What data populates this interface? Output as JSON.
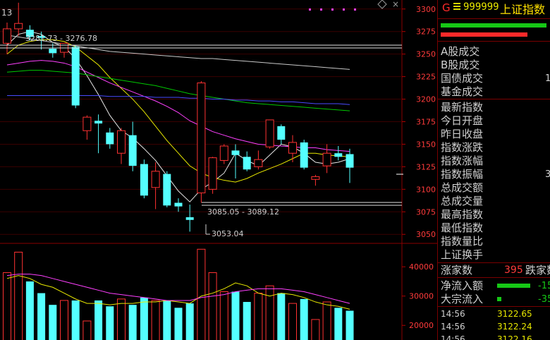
{
  "header": {
    "market_code": "G",
    "code": "999999",
    "name": "上证指数"
  },
  "top_left_label": "13",
  "indicator_bars": [
    {
      "color": "#16c816",
      "fraction": 1.0
    },
    {
      "color": "#ff2a2a",
      "fraction": 0.82
    }
  ],
  "colors": {
    "up": "#ff3232",
    "down": "#54ffff",
    "ma5": "#e8e8e8",
    "ma10": "#e8e800",
    "ma20": "#ff40ff",
    "ma30": "#00c800",
    "ma60": "#4a4aff",
    "ma_long": "#c8c8c8"
  },
  "price_axis": {
    "ticks": [
      "3300",
      "3275",
      "3250",
      "3225",
      "3200",
      "3175",
      "3150",
      "3125",
      "3100",
      "3075",
      "3050"
    ]
  },
  "volume_axis": {
    "ticks": [
      "40000",
      "30000",
      "20000"
    ]
  },
  "annotations": {
    "high_range": "3281.73 - 3276.78",
    "low_range": "3085.05 - 3089.12",
    "low_point": "3053.04"
  },
  "quote_labels": {
    "a_turnover": "A股成交",
    "b_turnover": "B股成交",
    "bond_turnover": "国债成交",
    "fund_turnover": "基金成交",
    "latest": "最新指数",
    "open": "今日开盘",
    "prev_close": "昨日收盘",
    "change": "指数涨跌",
    "change_pct": "指数涨幅",
    "amplitude": "指数振幅",
    "total_amount": "总成交额",
    "total_volume": "总成交量",
    "high": "最高指数",
    "low": "最低指数",
    "volume_ratio": "指数量比",
    "turnover_rate": "上证换手"
  },
  "cut_values": {
    "bond": "1",
    "amplitude": "3"
  },
  "breadth": {
    "up_label": "涨家数",
    "up_count": "395",
    "down_label": "跌家数"
  },
  "flows": [
    {
      "label": "净流入额",
      "value": "-15",
      "color": "#16c816",
      "fraction": 0.85
    },
    {
      "label": "大宗流入",
      "value": "-35",
      "color": "#16c816",
      "fraction": 0.1
    }
  ],
  "ticks_list": [
    {
      "time": "14:56",
      "price": "3122.65"
    },
    {
      "time": "14:56",
      "price": "3122.24"
    },
    {
      "time": "14:56",
      "price": "3122.16"
    }
  ],
  "chart_data": {
    "type": "candlestick",
    "price_range": [
      3040,
      3310
    ],
    "volume_range": [
      15000,
      48000
    ],
    "candles": [
      {
        "o": 3262,
        "h": 3285,
        "l": 3250,
        "c": 3278
      },
      {
        "o": 3278,
        "h": 3307,
        "l": 3270,
        "c": 3284
      },
      {
        "o": 3277,
        "h": 3282,
        "l": 3265,
        "c": 3269
      },
      {
        "o": 3270,
        "h": 3275,
        "l": 3255,
        "c": 3268
      },
      {
        "o": 3256,
        "h": 3262,
        "l": 3246,
        "c": 3251
      },
      {
        "o": 3252,
        "h": 3262,
        "l": 3246,
        "c": 3262
      },
      {
        "o": 3258,
        "h": 3260,
        "l": 3190,
        "c": 3193
      },
      {
        "o": 3165,
        "h": 3182,
        "l": 3155,
        "c": 3180
      },
      {
        "o": 3176,
        "h": 3183,
        "l": 3140,
        "c": 3173
      },
      {
        "o": 3163,
        "h": 3168,
        "l": 3145,
        "c": 3150
      },
      {
        "o": 3140,
        "h": 3168,
        "l": 3128,
        "c": 3165
      },
      {
        "o": 3160,
        "h": 3175,
        "l": 3120,
        "c": 3126
      },
      {
        "o": 3128,
        "h": 3133,
        "l": 3090,
        "c": 3093
      },
      {
        "o": 3102,
        "h": 3130,
        "l": 3078,
        "c": 3120
      },
      {
        "o": 3117,
        "h": 3120,
        "l": 3080,
        "c": 3082
      },
      {
        "o": 3085,
        "h": 3090,
        "l": 3075,
        "c": 3081
      },
      {
        "o": 3069,
        "h": 3083,
        "l": 3053,
        "c": 3066
      },
      {
        "o": 3096,
        "h": 3220,
        "l": 3085,
        "c": 3218
      },
      {
        "o": 3100,
        "h": 3136,
        "l": 3095,
        "c": 3135
      },
      {
        "o": 3132,
        "h": 3150,
        "l": 3128,
        "c": 3148
      },
      {
        "o": 3143,
        "h": 3150,
        "l": 3112,
        "c": 3138
      },
      {
        "o": 3136,
        "h": 3142,
        "l": 3120,
        "c": 3122
      },
      {
        "o": 3125,
        "h": 3143,
        "l": 3122,
        "c": 3133
      },
      {
        "o": 3147,
        "h": 3177,
        "l": 3145,
        "c": 3177
      },
      {
        "o": 3170,
        "h": 3172,
        "l": 3150,
        "c": 3155
      },
      {
        "o": 3140,
        "h": 3160,
        "l": 3130,
        "c": 3152
      },
      {
        "o": 3152,
        "h": 3155,
        "l": 3122,
        "c": 3124
      },
      {
        "o": 3111,
        "h": 3116,
        "l": 3104,
        "c": 3114
      },
      {
        "o": 3126,
        "h": 3150,
        "l": 3118,
        "c": 3140
      },
      {
        "o": 3140,
        "h": 3148,
        "l": 3132,
        "c": 3136
      },
      {
        "o": 3139,
        "h": 3145,
        "l": 3107,
        "c": 3124
      }
    ],
    "volumes": [
      38000,
      45000,
      35000,
      31000,
      27000,
      28500,
      28500,
      21500,
      28500,
      26500,
      29000,
      27000,
      29500,
      28500,
      28500,
      26000,
      27500,
      46000,
      38000,
      31500,
      31500,
      28000,
      31000,
      33500,
      31000,
      27500,
      29000,
      22000,
      28000,
      26000,
      25000
    ],
    "ma_lines": [
      {
        "name": "ma5",
        "values": [
          3260,
          3272,
          3275,
          3272,
          3263,
          3258,
          3245,
          3226,
          3205,
          3182,
          3165,
          3157,
          3145,
          3132,
          3115,
          3098,
          3086,
          3100,
          3108,
          3118,
          3140,
          3132,
          3126,
          3138,
          3150,
          3147,
          3140,
          3130,
          3128,
          3130,
          3134
        ]
      },
      {
        "name": "ma10",
        "values": [
          3250,
          3260,
          3264,
          3266,
          3266,
          3264,
          3258,
          3248,
          3238,
          3224,
          3212,
          3200,
          3186,
          3170,
          3154,
          3140,
          3126,
          3118,
          3113,
          3110,
          3108,
          3112,
          3118,
          3123,
          3128,
          3134,
          3140,
          3140,
          3138,
          3137,
          3136
        ]
      },
      {
        "name": "ma20",
        "values": [
          3238,
          3240,
          3242,
          3243,
          3242,
          3240,
          3236,
          3230,
          3224,
          3218,
          3213,
          3208,
          3203,
          3198,
          3192,
          3185,
          3176,
          3170,
          3164,
          3160,
          3156,
          3153,
          3150,
          3149,
          3148,
          3147,
          3146,
          3146,
          3144,
          3143,
          3142
        ]
      },
      {
        "name": "ma30",
        "values": [
          3230,
          3231,
          3232,
          3232,
          3231,
          3230,
          3229,
          3227,
          3225,
          3223,
          3221,
          3219,
          3217,
          3215,
          3212,
          3209,
          3206,
          3204,
          3202,
          3200,
          3198,
          3196,
          3195,
          3194,
          3193,
          3192,
          3191,
          3190,
          3189,
          3188,
          3187
        ]
      },
      {
        "name": "ma60",
        "values": [
          3204,
          3204,
          3204,
          3204,
          3204,
          3204,
          3204,
          3204,
          3204,
          3203,
          3203,
          3203,
          3203,
          3202,
          3202,
          3202,
          3201,
          3201,
          3200,
          3200,
          3199,
          3199,
          3198,
          3198,
          3197,
          3197,
          3196,
          3195,
          3195,
          3195,
          3194
        ]
      },
      {
        "name": "ma_long",
        "values": [
          3271,
          3269,
          3267,
          3265,
          3263,
          3261,
          3259,
          3257,
          3255,
          3253,
          3252,
          3251,
          3250,
          3249,
          3248,
          3247,
          3246,
          3245,
          3245,
          3244,
          3243,
          3242,
          3241,
          3240,
          3239,
          3238,
          3237,
          3236,
          3235,
          3234,
          3233
        ]
      }
    ],
    "vol_ma_lines": [
      {
        "name": "vol_ma5",
        "values": [
          36000,
          37000,
          36000,
          34000,
          33000,
          31000,
          29000,
          27500,
          27500,
          27000,
          27500,
          27500,
          28000,
          28000,
          28500,
          28000,
          27500,
          30000,
          31000,
          32500,
          34500,
          33500,
          31000,
          30000,
          31000,
          30500,
          29500,
          28000,
          27000,
          26500,
          25500
        ]
      },
      {
        "name": "vol_ma10",
        "values": [
          37000,
          37500,
          37500,
          37000,
          36000,
          35000,
          34000,
          33000,
          32000,
          31000,
          30500,
          30000,
          29500,
          29000,
          28500,
          28500,
          28500,
          29500,
          30000,
          30500,
          31500,
          32000,
          32500,
          32500,
          32500,
          32000,
          31500,
          30500,
          29500,
          28500,
          27500
        ]
      }
    ]
  }
}
